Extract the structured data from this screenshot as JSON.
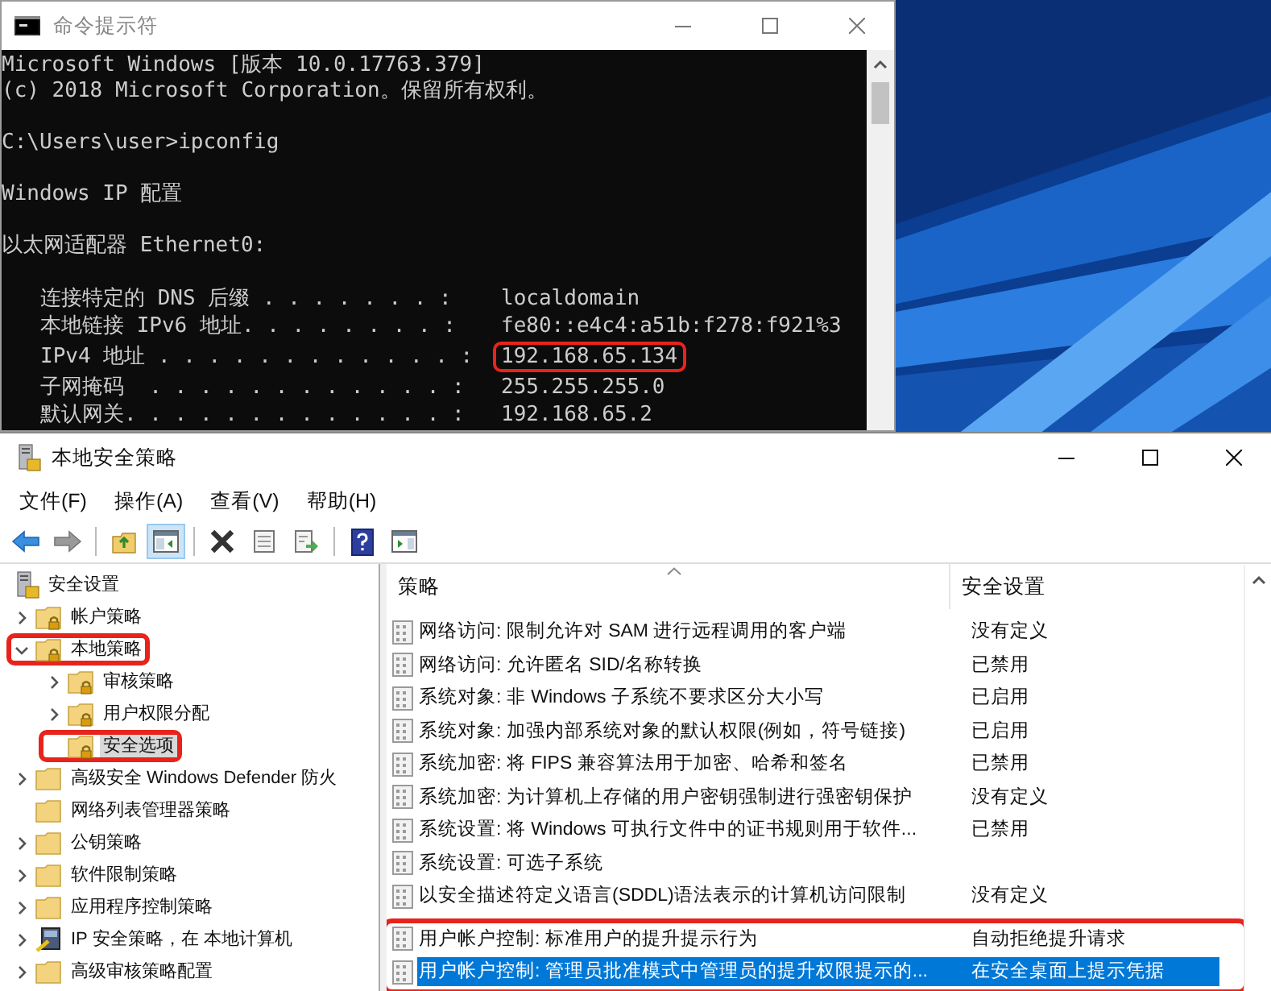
{
  "cmd_window": {
    "title": "命令提示符",
    "blocks": [
      [
        "Microsoft Windows [版本 10.0.17763.379]",
        "(c) 2018 Microsoft Corporation。保留所有权利。"
      ],
      [
        "C:\\Users\\user>ipconfig"
      ],
      [
        "Windows IP 配置"
      ],
      [
        "以太网适配器 Ethernet0:"
      ]
    ],
    "entries": [
      {
        "label": "连接特定的 DNS 后缀 . . . . . . . :",
        "value": "localdomain",
        "highlighted": false
      },
      {
        "label": "本地链接 IPv6 地址. . . . . . . . :",
        "value": "fe80::e4c4:a51b:f278:f921%3",
        "highlighted": false
      },
      {
        "label": "IPv4 地址 . . . . . . . . . . . . :",
        "value": "192.168.65.134",
        "highlighted": true
      },
      {
        "label": "子网掩码  . . . . . . . . . . . . :",
        "value": "255.255.255.0",
        "highlighted": false
      },
      {
        "label": "默认网关. . . . . . . . . . . . . :",
        "value": "192.168.65.2",
        "highlighted": false
      }
    ]
  },
  "policy_window": {
    "title": "本地安全策略",
    "menu": [
      "文件(F)",
      "操作(A)",
      "查看(V)",
      "帮助(H)"
    ],
    "toolbar": [
      {
        "kind": "back",
        "pressed": false
      },
      {
        "kind": "forward",
        "pressed": false
      },
      {
        "kind": "separator"
      },
      {
        "kind": "up",
        "pressed": false
      },
      {
        "kind": "show-tree",
        "pressed": true
      },
      {
        "kind": "separator"
      },
      {
        "kind": "delete",
        "pressed": false
      },
      {
        "kind": "properties",
        "pressed": false
      },
      {
        "kind": "export",
        "pressed": false
      },
      {
        "kind": "separator"
      },
      {
        "kind": "help",
        "pressed": false
      },
      {
        "kind": "action-pane",
        "pressed": false
      }
    ],
    "tree": [
      {
        "label": "安全设置",
        "kind": "root",
        "selected": false,
        "highlighted": false,
        "children": [
          {
            "label": "帐户策略",
            "kind": "folder",
            "locked": true,
            "expanded": false,
            "selected": false,
            "highlighted": false
          },
          {
            "label": "本地策略",
            "kind": "folder",
            "locked": true,
            "expanded": true,
            "selected": false,
            "highlighted": true,
            "children": [
              {
                "label": "审核策略",
                "kind": "folder",
                "locked": true,
                "expanded": false,
                "selected": false,
                "highlighted": false
              },
              {
                "label": "用户权限分配",
                "kind": "folder",
                "locked": true,
                "expanded": false,
                "selected": false,
                "highlighted": false
              },
              {
                "label": "安全选项",
                "kind": "folder",
                "locked": true,
                "selected": true,
                "highlighted": true
              }
            ]
          },
          {
            "label": "高级安全 Windows Defender 防火",
            "kind": "folder",
            "locked": false,
            "expanded": false,
            "selected": false,
            "highlighted": false
          },
          {
            "label": "网络列表管理器策略",
            "kind": "folder",
            "locked": false,
            "selected": false,
            "highlighted": false
          },
          {
            "label": "公钥策略",
            "kind": "folder",
            "locked": false,
            "expanded": false,
            "selected": false,
            "highlighted": false
          },
          {
            "label": "软件限制策略",
            "kind": "folder",
            "locked": false,
            "expanded": false,
            "selected": false,
            "highlighted": false
          },
          {
            "label": "应用程序控制策略",
            "kind": "folder",
            "locked": false,
            "expanded": false,
            "selected": false,
            "highlighted": false
          },
          {
            "label": "IP 安全策略，在 本地计算机",
            "kind": "computer",
            "expanded": false,
            "selected": false,
            "highlighted": false
          },
          {
            "label": "高级审核策略配置",
            "kind": "folder",
            "locked": false,
            "expanded": false,
            "selected": false,
            "highlighted": false
          }
        ]
      }
    ],
    "columns": [
      "策略",
      "安全设置"
    ],
    "rows": [
      {
        "policy": "网络访问: 限制允许对 SAM 进行远程调用的客户端",
        "setting": "没有定义",
        "selected": false,
        "highlighted": false
      },
      {
        "policy": "网络访问: 允许匿名 SID/名称转换",
        "setting": "已禁用",
        "selected": false,
        "highlighted": false
      },
      {
        "policy": "系统对象: 非 Windows 子系统不要求区分大小写",
        "setting": "已启用",
        "selected": false,
        "highlighted": false
      },
      {
        "policy": "系统对象: 加强内部系统对象的默认权限(例如，符号链接)",
        "setting": "已启用",
        "selected": false,
        "highlighted": false
      },
      {
        "policy": "系统加密: 将 FIPS 兼容算法用于加密、哈希和签名",
        "setting": "已禁用",
        "selected": false,
        "highlighted": false
      },
      {
        "policy": "系统加密: 为计算机上存储的用户密钥强制进行强密钥保护",
        "setting": "没有定义",
        "selected": false,
        "highlighted": false
      },
      {
        "policy": "系统设置: 将 Windows 可执行文件中的证书规则用于软件...",
        "setting": "已禁用",
        "selected": false,
        "highlighted": false
      },
      {
        "policy": "系统设置: 可选子系统",
        "selected": false,
        "highlighted": false
      },
      {
        "policy": "以安全描述符定义语言(SDDL)语法表示的计算机访问限制",
        "setting": "没有定义",
        "selected": false,
        "highlighted": false
      },
      {
        "policy": "用户帐户控制: 标准用户的提升提示行为",
        "setting": "自动拒绝提升请求",
        "selected": false,
        "highlighted": true
      },
      {
        "policy": "用户帐户控制: 管理员批准模式中管理员的提升权限提示的...",
        "setting": "在安全桌面上提示凭据",
        "selected": true,
        "highlighted": true
      }
    ]
  }
}
